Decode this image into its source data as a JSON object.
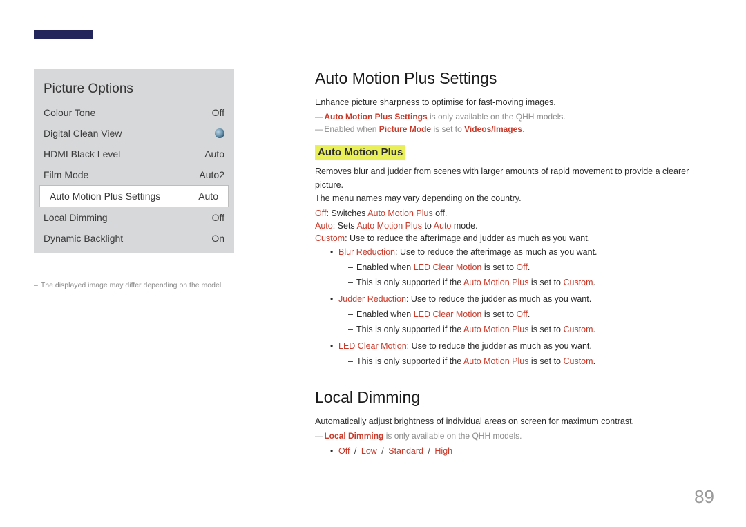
{
  "page_number": "89",
  "menu": {
    "title": "Picture Options",
    "rows": [
      {
        "label": "Colour Tone",
        "value": "Off",
        "selected": false,
        "dot": false
      },
      {
        "label": "Digital Clean View",
        "value": "",
        "selected": false,
        "dot": true
      },
      {
        "label": "HDMI Black Level",
        "value": "Auto",
        "selected": false,
        "dot": false
      },
      {
        "label": "Film Mode",
        "value": "Auto2",
        "selected": false,
        "dot": false
      },
      {
        "label": "Auto Motion Plus Settings",
        "value": "Auto",
        "selected": true,
        "dot": false
      },
      {
        "label": "Local Dimming",
        "value": "Off",
        "selected": false,
        "dot": false
      },
      {
        "label": "Dynamic Backlight",
        "value": "On",
        "selected": false,
        "dot": false
      }
    ],
    "footnote_dash": "–",
    "footnote": "The displayed image may differ depending on the model."
  },
  "amp": {
    "heading": "Auto Motion Plus Settings",
    "intro": "Enhance picture sharpness to optimise for fast-moving images.",
    "note1": {
      "dash": "―",
      "key": "Auto Motion Plus Settings",
      "rest": " is only available on the QHH models."
    },
    "note2": {
      "dash": "―",
      "pre": "Enabled when ",
      "key1": "Picture Mode",
      "mid": " is set to ",
      "key2": "Videos/Images",
      "end": "."
    },
    "sub_heading": "Auto Motion Plus",
    "desc1": "Removes blur and judder from scenes with larger amounts of rapid movement to provide a clearer picture.",
    "desc2": "The menu names may vary depending on the country.",
    "off_line": {
      "key": "Off",
      "sep": ": Switches ",
      "key2": "Auto Motion Plus",
      "end": " off."
    },
    "auto_line": {
      "key": "Auto",
      "sep": ": Sets ",
      "key2": "Auto Motion Plus",
      "mid": " to ",
      "key3": "Auto",
      "end": " mode."
    },
    "custom_line": {
      "key": "Custom",
      "rest": ": Use to reduce the afterimage and judder as much as you want."
    },
    "bullets": [
      {
        "key": "Blur Reduction",
        "rest": ": Use to reduce the afterimage as much as you want.",
        "sub": [
          {
            "pre": "Enabled when ",
            "key": "LED Clear Motion",
            "mid": " is set to ",
            "key2": "Off",
            "end": "."
          },
          {
            "pre": "This is only supported if the ",
            "key": "Auto Motion Plus",
            "mid": " is set to ",
            "key2": "Custom",
            "end": "."
          }
        ]
      },
      {
        "key": "Judder Reduction",
        "rest": ": Use to reduce the judder as much as you want.",
        "sub": [
          {
            "pre": "Enabled when ",
            "key": "LED Clear Motion",
            "mid": " is set to ",
            "key2": "Off",
            "end": "."
          },
          {
            "pre": "This is only supported if the ",
            "key": "Auto Motion Plus",
            "mid": " is set to ",
            "key2": "Custom",
            "end": "."
          }
        ]
      },
      {
        "key": "LED Clear Motion",
        "rest": ": Use to reduce the judder as much as you want.",
        "sub": [
          {
            "pre": "This is only supported if the ",
            "key": "Auto Motion Plus",
            "mid": " is set to ",
            "key2": "Custom",
            "end": "."
          }
        ]
      }
    ]
  },
  "ld": {
    "heading": "Local Dimming",
    "intro": "Automatically adjust brightness of individual areas on screen for maximum contrast.",
    "note": {
      "dash": "―",
      "key": "Local Dimming",
      "rest": " is only available on the QHH models."
    },
    "opts": [
      "Off",
      "Low",
      "Standard",
      "High"
    ],
    "sep": " / "
  }
}
